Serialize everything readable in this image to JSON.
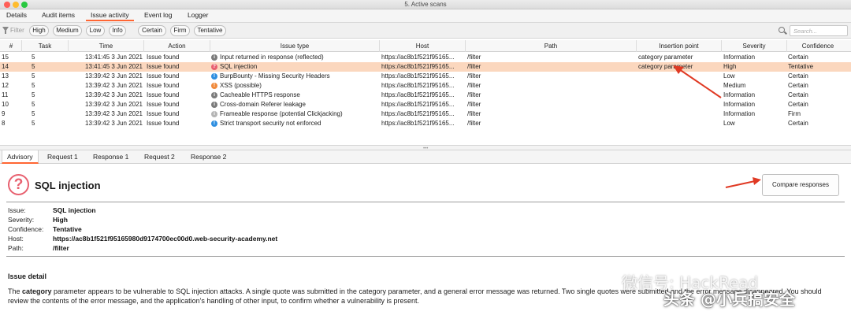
{
  "window": {
    "title": "5. Active scans"
  },
  "top_tabs": [
    {
      "label": "Details"
    },
    {
      "label": "Audit items"
    },
    {
      "label": "Issue activity"
    },
    {
      "label": "Event log"
    },
    {
      "label": "Logger"
    }
  ],
  "filter": {
    "label": "Filter",
    "pills": [
      "High",
      "Medium",
      "Low",
      "Info",
      "Certain",
      "Firm",
      "Tentative"
    ],
    "search_placeholder": "Search..."
  },
  "table": {
    "columns": [
      "#",
      "Task",
      "Time",
      "Action",
      "Issue type",
      "Host",
      "Path",
      "Insertion point",
      "Severity",
      "Confidence"
    ],
    "rows": [
      {
        "num": "15",
        "task": "5",
        "time": "13:41:45 3 Jun 2021",
        "action": "Issue found",
        "icon": "info",
        "issue": "Input returned in response (reflected)",
        "host": "https://ac8b1f521f95165...",
        "path": "/filter",
        "insertion": "category parameter",
        "severity": "Information",
        "confidence": "Certain"
      },
      {
        "num": "14",
        "task": "5",
        "time": "13:41:45 3 Jun 2021",
        "action": "Issue found",
        "icon": "high",
        "issue": "SQL injection",
        "host": "https://ac8b1f521f95165...",
        "path": "/filter",
        "insertion": "category parameter",
        "severity": "High",
        "confidence": "Tentative"
      },
      {
        "num": "13",
        "task": "5",
        "time": "13:39:42 3 Jun 2021",
        "action": "Issue found",
        "icon": "low",
        "issue": "BurpBounty - Missing Security Headers",
        "host": "https://ac8b1f521f95165...",
        "path": "/filter",
        "insertion": "",
        "severity": "Low",
        "confidence": "Certain"
      },
      {
        "num": "12",
        "task": "5",
        "time": "13:39:42 3 Jun 2021",
        "action": "Issue found",
        "icon": "medium",
        "issue": "XSS (possible)",
        "host": "https://ac8b1f521f95165...",
        "path": "/filter",
        "insertion": "",
        "severity": "Medium",
        "confidence": "Certain"
      },
      {
        "num": "11",
        "task": "5",
        "time": "13:39:42 3 Jun 2021",
        "action": "Issue found",
        "icon": "info",
        "issue": "Cacheable HTTPS response",
        "host": "https://ac8b1f521f95165...",
        "path": "/filter",
        "insertion": "",
        "severity": "Information",
        "confidence": "Certain"
      },
      {
        "num": "10",
        "task": "5",
        "time": "13:39:42 3 Jun 2021",
        "action": "Issue found",
        "icon": "info",
        "issue": "Cross-domain Referer leakage",
        "host": "https://ac8b1f521f95165...",
        "path": "/filter",
        "insertion": "",
        "severity": "Information",
        "confidence": "Certain"
      },
      {
        "num": "9",
        "task": "5",
        "time": "13:39:42 3 Jun 2021",
        "action": "Issue found",
        "icon": "info-light",
        "issue": "Frameable response (potential Clickjacking)",
        "host": "https://ac8b1f521f95165...",
        "path": "/filter",
        "insertion": "",
        "severity": "Information",
        "confidence": "Firm"
      },
      {
        "num": "8",
        "task": "5",
        "time": "13:39:42 3 Jun 2021",
        "action": "Issue found",
        "icon": "low",
        "issue": "Strict transport security not enforced",
        "host": "https://ac8b1f521f95165...",
        "path": "/filter",
        "insertion": "",
        "severity": "Low",
        "confidence": "Certain"
      }
    ]
  },
  "bottom_tabs": [
    {
      "label": "Advisory"
    },
    {
      "label": "Request 1"
    },
    {
      "label": "Response 1"
    },
    {
      "label": "Request 2"
    },
    {
      "label": "Response 2"
    }
  ],
  "advisory": {
    "title": "SQL injection",
    "compare_label": "Compare responses",
    "meta": [
      {
        "key": "Issue:",
        "value": "SQL injection"
      },
      {
        "key": "Severity:",
        "value": "High"
      },
      {
        "key": "Confidence:",
        "value": "Tentative"
      },
      {
        "key": "Host:",
        "value": "https://ac8b1f521f95165980d9174700ec00d0.web-security-academy.net"
      },
      {
        "key": "Path:",
        "value": "/filter"
      }
    ],
    "detail_heading": "Issue detail",
    "detail_pre": "The ",
    "detail_bold": "category",
    "detail_post": " parameter appears to be vulnerable to SQL injection attacks. A single quote was submitted in the category parameter, and a general error message was returned. Two single quotes were submitted and the error message disappeared. You should review the contents of the error message, and the application's handling of other input, to confirm whether a vulnerability is present."
  },
  "icon_colors": {
    "info": "#7b7b7b",
    "info-light": "#b5b5b5",
    "high": "#e8606f",
    "medium": "#f08a3c",
    "low": "#2f8fe0"
  },
  "accent": "#ff6633",
  "selected_row": "#fbd7be",
  "annotation_arrow": "#e03a24",
  "watermark": {
    "line1": "微信号: HackRead",
    "line2": "头条 @小兵搞安全"
  }
}
